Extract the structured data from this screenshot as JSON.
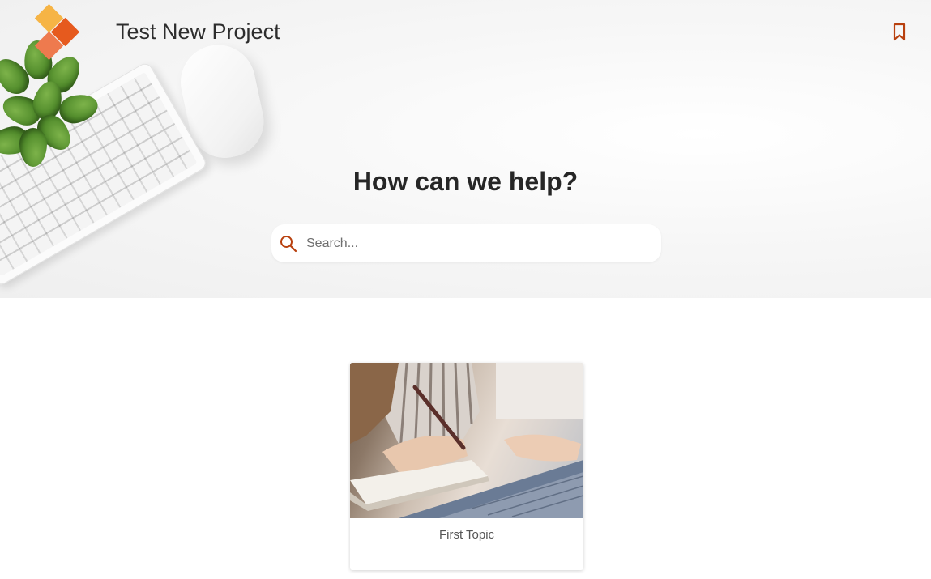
{
  "header": {
    "site_title": "Test New Project",
    "logo_icon": "project-logo-icon",
    "bookmark_icon": "bookmark-icon"
  },
  "hero": {
    "heading": "How can we help?",
    "search": {
      "placeholder": "Search...",
      "value": "",
      "icon": "search-icon"
    }
  },
  "topics": [
    {
      "title": "First Topic",
      "image": "woman-writing-notebook-laptop-photo"
    }
  ],
  "colors": {
    "accent": "#b8400e",
    "logo_yellow": "#f6b445",
    "logo_orange": "#e65a1e",
    "logo_salmon": "#ee7a4e"
  }
}
